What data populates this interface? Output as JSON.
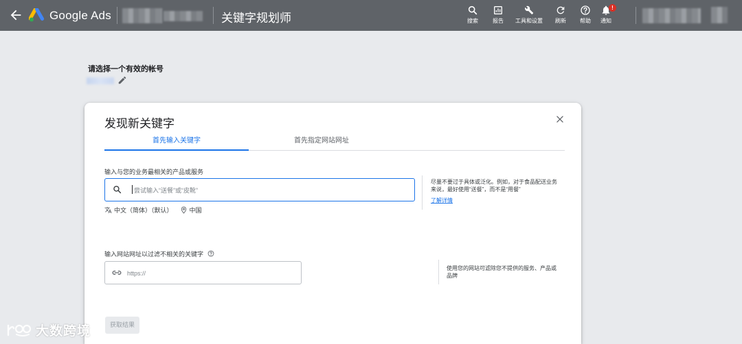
{
  "header": {
    "product_name": "Google Ads",
    "page_title": "关键字规划师",
    "tools": [
      {
        "icon": "search-icon",
        "label": "搜索"
      },
      {
        "icon": "reports-icon",
        "label": "报告"
      },
      {
        "icon": "wrench-icon",
        "label": "工具和设置"
      },
      {
        "icon": "refresh-icon",
        "label": "刷新"
      },
      {
        "icon": "help-icon",
        "label": "帮助"
      },
      {
        "icon": "bell-icon",
        "label": "通知"
      }
    ],
    "notification_badge": "!"
  },
  "account": {
    "title": "请选择一个有效的帐号"
  },
  "dialog": {
    "title": "发现新关键字",
    "tabs": [
      {
        "label": "首先输入关键字",
        "active": true
      },
      {
        "label": "首先指定网站网址",
        "active": false
      }
    ],
    "keyword_section": {
      "label": "输入与您的业务最相关的产品或服务",
      "placeholder": "尝试输入“送餐”或“皮靴”",
      "value": "",
      "language": "中文（简体）（默认）",
      "location": "中国",
      "tip": "尽量不要过于具体或泛化。例如，对于食品配送业务来说，最好使用“送餐”，而不是“用餐”",
      "learn_more": "了解详情"
    },
    "url_section": {
      "label": "输入网站网址以过滤不相关的关键字",
      "placeholder": "https://",
      "value": "",
      "tip": "使用您的网站可滤除您不提供的服务、产品或品牌"
    },
    "submit_label": "获取结果"
  },
  "watermark": {
    "text": "大数跨境"
  },
  "colors": {
    "topbar": "#5f6368",
    "accent": "#1a73e8",
    "background": "#e8eaed",
    "badge": "#d93025"
  }
}
